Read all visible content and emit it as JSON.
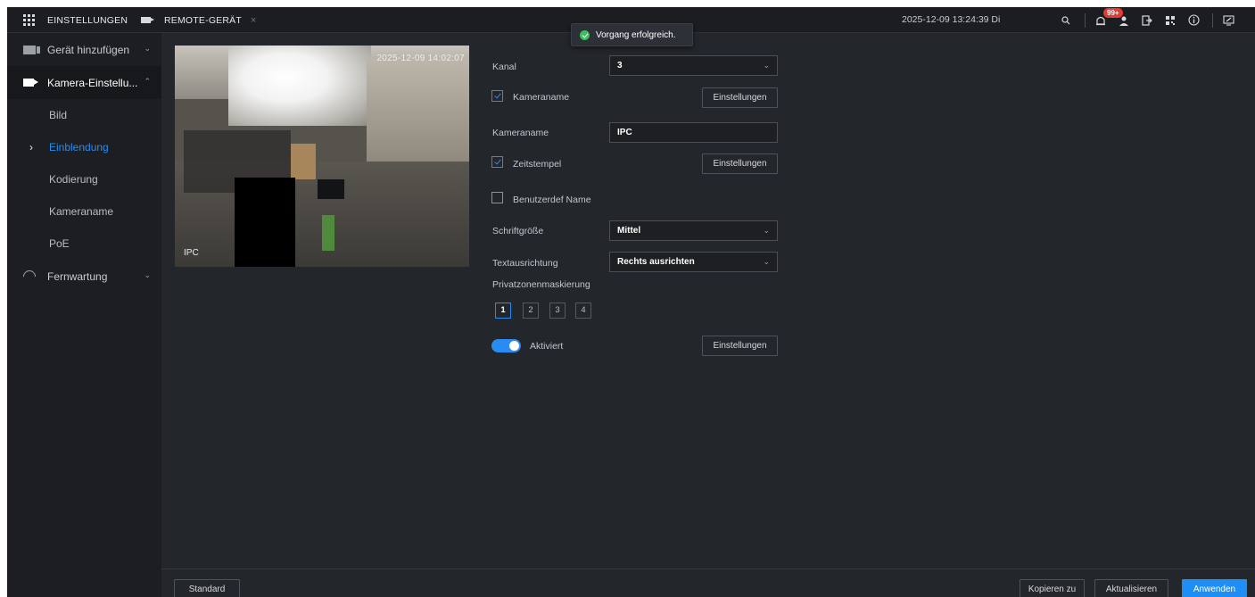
{
  "topbar": {
    "tabs": [
      {
        "label": "EINSTELLUNGEN"
      },
      {
        "label": "REMOTE-GERÄT",
        "close": "×"
      }
    ],
    "datetime": "2025-12-09 13:24:39 Di",
    "alarm_badge": "99+"
  },
  "toast": {
    "message": "Vorgang erfolgreich."
  },
  "sidebar": {
    "groups": [
      {
        "label": "Gerät hinzufügen",
        "chevron": "⌄"
      },
      {
        "label": "Kamera-Einstellu...",
        "chevron": "⌃"
      },
      {
        "label": "Fernwartung",
        "chevron": "⌄"
      }
    ],
    "sub_items": [
      {
        "label": "Bild"
      },
      {
        "label": "Einblendung",
        "arrow": "›"
      },
      {
        "label": "Kodierung"
      },
      {
        "label": "Kameraname"
      },
      {
        "label": "PoE"
      }
    ]
  },
  "preview": {
    "timestamp": "2025-12-09 14:02:07",
    "camera_name": "IPC"
  },
  "form": {
    "kanal_label": "Kanal",
    "kanal_value": "3",
    "kameraname_checkbox_label": "Kameraname",
    "kameraname_checked": true,
    "settings_label": "Einstellungen",
    "kameraname_field_label": "Kameraname",
    "kameraname_value": "IPC",
    "zeitstempel_label": "Zeitstempel",
    "zeitstempel_checked": true,
    "benutzerdef_label": "Benutzerdef Name",
    "benutzerdef_checked": false,
    "schriftgroesse_label": "Schriftgröße",
    "schriftgroesse_value": "Mittel",
    "textausrichtung_label": "Textausrichtung",
    "textausrichtung_value": "Rechts ausrichten",
    "privatzonen_label": "Privatzonenmaskierung",
    "zones": [
      "1",
      "2",
      "3",
      "4"
    ],
    "selected_zone": "1",
    "aktiviert_label": "Aktiviert",
    "aktiviert_on": true,
    "dropdown_glyph": "⌄"
  },
  "footer": {
    "standard_label": "Standard",
    "copy_label": "Kopieren zu",
    "refresh_label": "Aktualisieren",
    "apply_label": "Anwenden"
  },
  "colors": {
    "accent": "#2a8cf0",
    "background": "#23262b",
    "sidebar": "#1c1e22",
    "topbar": "#1b1d21",
    "success": "#3cbf5a",
    "badge": "#e53935"
  }
}
